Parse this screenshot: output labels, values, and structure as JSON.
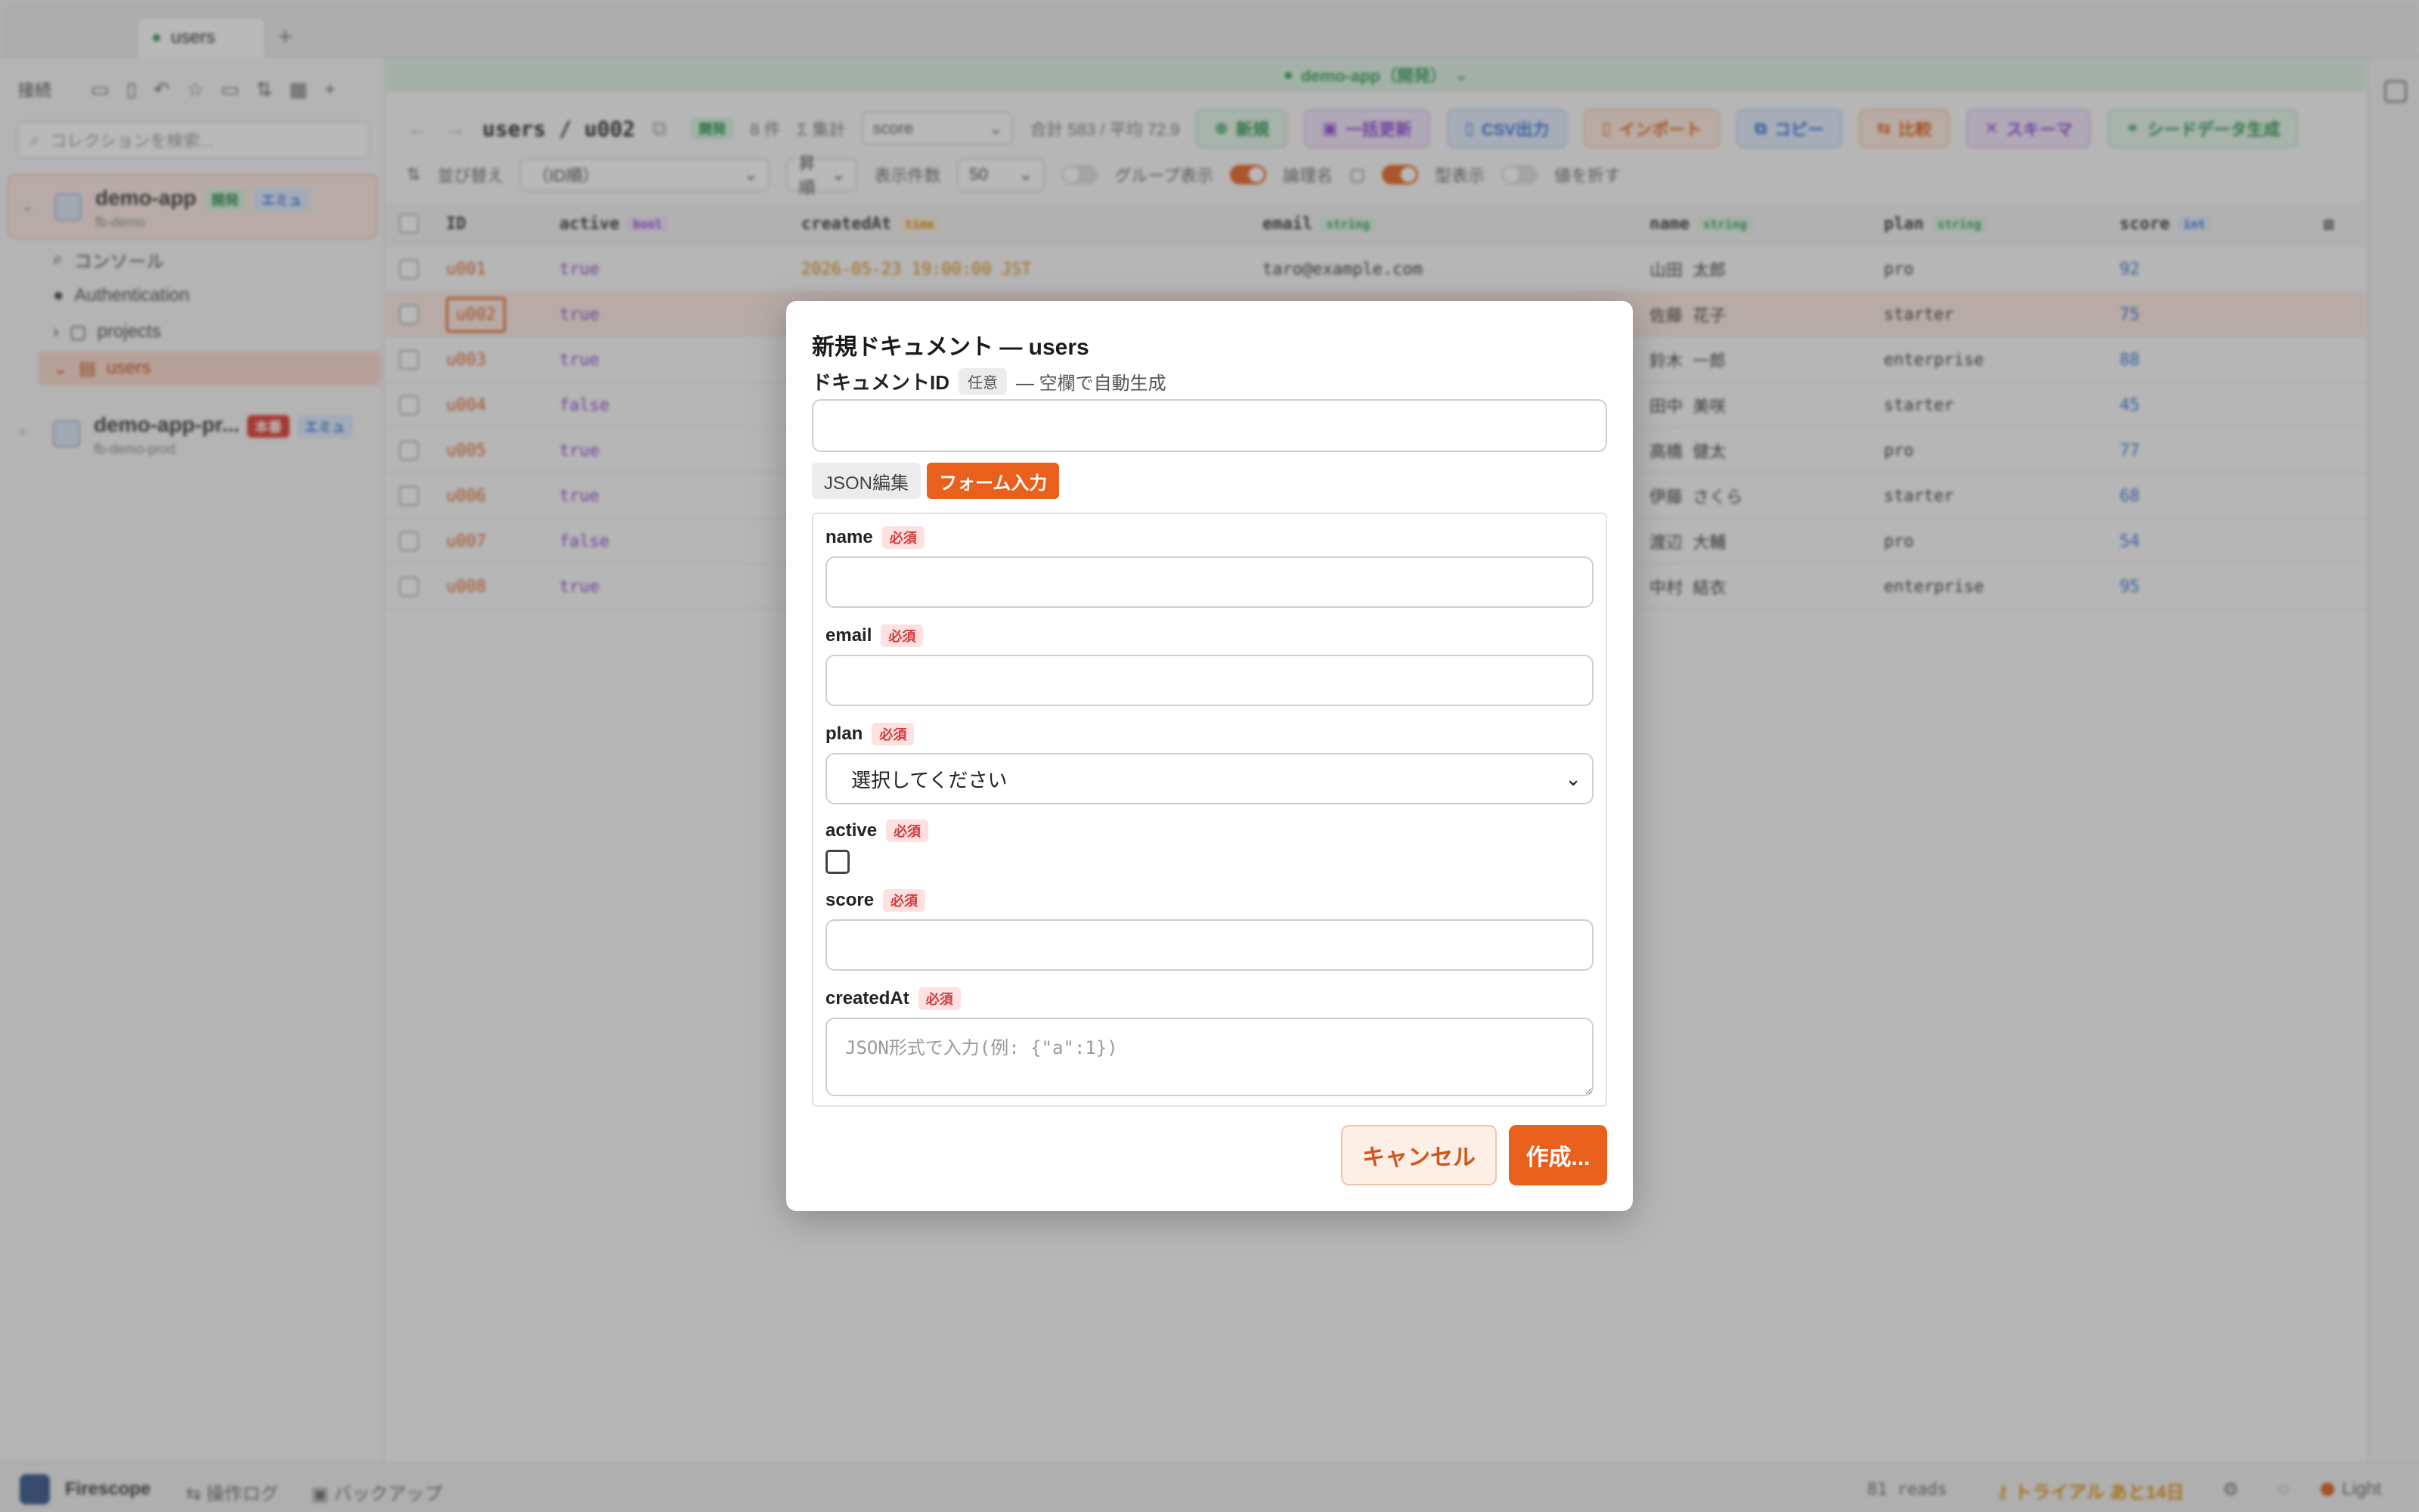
{
  "tabbar": {
    "tab_label": "users",
    "add_label": "+"
  },
  "sidebar": {
    "label": "接続",
    "search_placeholder": "コレクションを検索...",
    "projects": [
      {
        "name": "demo-app",
        "sub": "fb-demo",
        "badge1": "開発",
        "badge2": "エミュ"
      },
      {
        "name": "demo-app-pr...",
        "sub": "fb-demo-prod",
        "badge1": "本番",
        "badge2": "エミュ"
      }
    ],
    "tree": [
      "コンソール",
      "Authentication",
      "projects",
      "users"
    ]
  },
  "env_bar": {
    "label": "demo-app（開発）"
  },
  "header": {
    "breadcrumb": "users / u002",
    "env_badge": "開発",
    "count": "8 件",
    "agg": "Σ 集計",
    "agg_field": "score",
    "agg_result": "合計 583 / 平均 72.9",
    "actions": [
      "新規",
      "一括更新",
      "CSV出力",
      "インポート",
      "コピー",
      "比較",
      "スキーマ",
      "シードデータ生成"
    ]
  },
  "filters": {
    "sort_label": "並び替え",
    "sort_value": "（ID順）",
    "direction": "昇順",
    "page_size_label": "表示件数",
    "page_size": "50",
    "group_label": "グループ表示",
    "logical_label": "論理名",
    "type_label": "型表示",
    "wrap_label": "値を折す"
  },
  "table": {
    "columns": [
      {
        "name": "ID",
        "type": ""
      },
      {
        "name": "active",
        "type": "bool"
      },
      {
        "name": "createdAt",
        "type": "time"
      },
      {
        "name": "email",
        "type": "string"
      },
      {
        "name": "name",
        "type": "string"
      },
      {
        "name": "plan",
        "type": "string"
      },
      {
        "name": "score",
        "type": "int"
      }
    ],
    "rows": [
      {
        "id": "u001",
        "active": "true",
        "createdAt": "2026-05-23 19:00:00 JST",
        "email": "taro@example.com",
        "name": "山田 太郎",
        "plan": "pro",
        "score": "92"
      },
      {
        "id": "u002",
        "active": "true",
        "createdAt": "",
        "email": "",
        "name": "佐藤 花子",
        "plan": "starter",
        "score": "75"
      },
      {
        "id": "u003",
        "active": "true",
        "createdAt": "",
        "email": "",
        "name": "鈴木 一郎",
        "plan": "enterprise",
        "score": "88"
      },
      {
        "id": "u004",
        "active": "false",
        "createdAt": "",
        "email": "",
        "name": "田中 美咲",
        "plan": "starter",
        "score": "45"
      },
      {
        "id": "u005",
        "active": "true",
        "createdAt": "",
        "email": "",
        "name": "高橋 健太",
        "plan": "pro",
        "score": "77"
      },
      {
        "id": "u006",
        "active": "true",
        "createdAt": "",
        "email": "",
        "name": "伊藤 さくら",
        "plan": "starter",
        "score": "68"
      },
      {
        "id": "u007",
        "active": "false",
        "createdAt": "",
        "email": "",
        "name": "渡辺 大輔",
        "plan": "pro",
        "score": "54"
      },
      {
        "id": "u008",
        "active": "true",
        "createdAt": "",
        "email": "",
        "name": "中村 結衣",
        "plan": "enterprise",
        "score": "95"
      }
    ]
  },
  "statusbar": {
    "app": "Firescope",
    "log": "操作ログ",
    "backup": "バックアップ",
    "reads": "81 reads",
    "trial": "トライアル あと14日",
    "theme": "Light"
  },
  "modal": {
    "title": "新規ドキュメント — users",
    "id_label": "ドキュメントID",
    "id_badge": "任意",
    "id_hint": "— 空欄で自動生成",
    "tab_json": "JSON編集",
    "tab_form": "フォーム入力",
    "required": "必須",
    "fields": {
      "name": "name",
      "email": "email",
      "plan": "plan",
      "plan_placeholder": "選択してください",
      "active": "active",
      "score": "score",
      "createdAt": "createdAt",
      "createdAt_placeholder": "JSON形式で入力(例: {\"a\":1})"
    },
    "cancel": "キャンセル",
    "create": "作成..."
  }
}
